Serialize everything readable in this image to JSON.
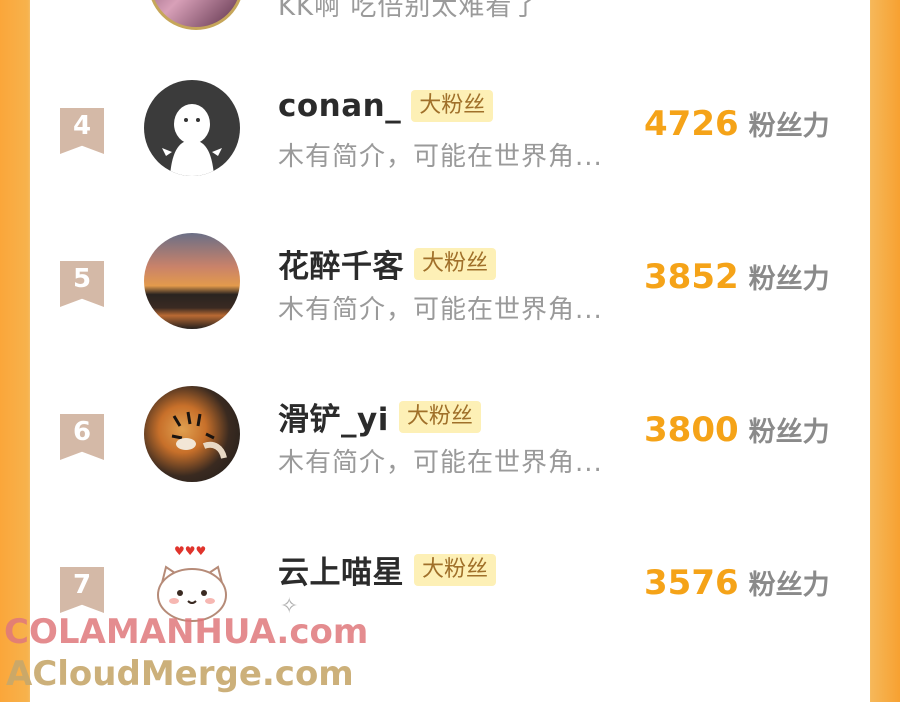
{
  "top_partial": {
    "bio": "KK啊 吃倍别太难看了"
  },
  "rows": [
    {
      "rank": "4",
      "name": "conan_",
      "tag": "大粉丝",
      "bio": "木有简介，可能在世界角...",
      "score": "4726",
      "unit": "粉丝力"
    },
    {
      "rank": "5",
      "name": "花醉千客",
      "tag": "大粉丝",
      "bio": "木有简介，可能在世界角...",
      "score": "3852",
      "unit": "粉丝力"
    },
    {
      "rank": "6",
      "name": "滑铲_yi",
      "tag": "大粉丝",
      "bio": "木有简介，可能在世界角...",
      "score": "3800",
      "unit": "粉丝力"
    },
    {
      "rank": "7",
      "name": "云上喵星",
      "tag": "大粉丝",
      "bio": "",
      "score": "3576",
      "unit": "粉丝力"
    }
  ],
  "watermark": {
    "line1": "COLAMANHUA.com",
    "line2": "ACloudMerge.com"
  },
  "colors": {
    "score": "#f5a318",
    "tag_bg": "#fdf0b6",
    "rank_badge": "#d4b9a7",
    "side_orange": "#fba63a"
  }
}
